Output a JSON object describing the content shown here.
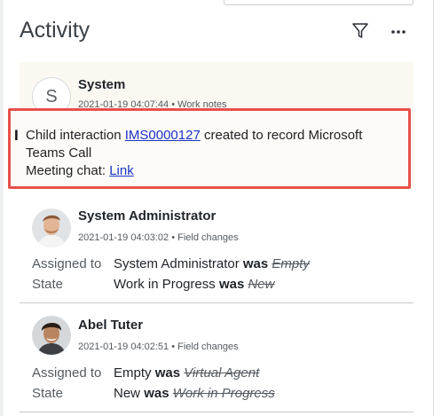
{
  "header": {
    "title": "Activity",
    "filter_icon": "filter-icon",
    "more_icon": "more-options-icon"
  },
  "colors": {
    "highlight_border": "#e8504a",
    "link": "#1a32c4",
    "system_bg": "#fbf8f2"
  },
  "entries": [
    {
      "avatar_letter": "S",
      "author": "System",
      "meta": "2021-01-19 04:07:44 • Work notes",
      "body_prefix": "Child interaction ",
      "body_link": "IMS0000127",
      "body_suffix": " created to record Microsoft Teams Call",
      "chat_label": "Meeting chat: ",
      "chat_link": "Link"
    },
    {
      "author": "System Administrator",
      "meta": "2021-01-19 04:03:02 • Field changes",
      "changes": [
        {
          "field": "Assigned to",
          "new": "System Administrator",
          "was": "was",
          "old": "Empty"
        },
        {
          "field": "State",
          "new": "Work in Progress",
          "was": "was",
          "old": "New"
        }
      ]
    },
    {
      "author": "Abel Tuter",
      "meta": "2021-01-19 04:02:51 • Field changes",
      "changes": [
        {
          "field": "Assigned to",
          "new": "Empty",
          "was": "was",
          "old": "Virtual Agent"
        },
        {
          "field": "State",
          "new": "New",
          "was": "was",
          "old": "Work in Progress"
        }
      ]
    }
  ]
}
